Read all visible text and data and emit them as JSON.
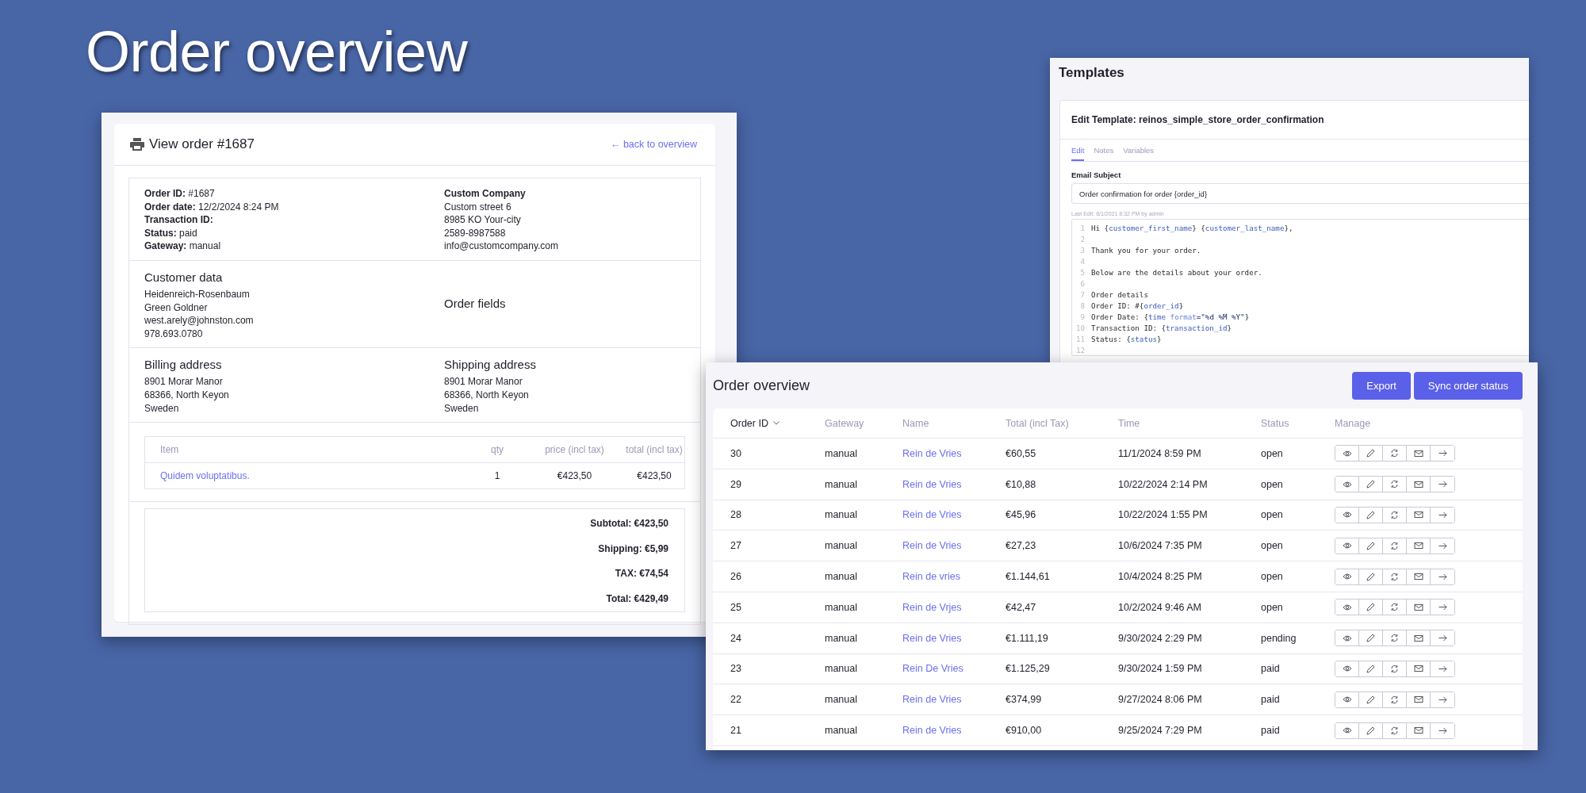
{
  "page_title": "Order overview",
  "order_view": {
    "title": "View order #1687",
    "back_link": "← back to overview",
    "details": [
      "**Order ID:** #1687",
      "**Order date:** 12/2/2024 8:24 PM",
      "**Transaction ID:**",
      "**Status:** paid",
      "**Gateway:** manual"
    ],
    "company": {
      "name": "Custom Company",
      "lines": [
        "Custom street 6",
        "8985 KO Your-city",
        "2589-8987588",
        "info@customcompany.com"
      ]
    },
    "customer": {
      "heading": "Customer data",
      "lines": [
        "Heidenreich-Rosenbaum",
        "Green Goldner",
        "west.arely@johnston.com",
        "978.693.0780"
      ]
    },
    "order_fields": {
      "heading": "Order fields"
    },
    "billing": {
      "heading": "Billing address",
      "lines": [
        "8901 Morar Manor",
        "68366, North Keyon",
        "Sweden"
      ]
    },
    "shipping": {
      "heading": "Shipping address",
      "lines": [
        "8901 Morar Manor",
        "68366, North Keyon",
        "Sweden"
      ]
    },
    "items": {
      "columns": [
        "Item",
        "qty",
        "price (incl tax)",
        "total (incl tax)"
      ],
      "rows": [
        {
          "item": "Quidem voluptatibus.",
          "qty": "1",
          "price": "€423,50",
          "total": "€423,50"
        }
      ]
    },
    "totals": [
      "Subtotal: €423,50",
      "Shipping: €5,99",
      "TAX: €74,54",
      "Total: €429,49"
    ]
  },
  "templates": {
    "title": "Templates",
    "card_title": "Edit Template: reinos_simple_store_order_confirmation",
    "tabs": [
      {
        "label": "Edit",
        "selected": true
      },
      {
        "label": "Notes",
        "selected": false
      },
      {
        "label": "Variables",
        "selected": false
      }
    ],
    "subject_label": "Email Subject",
    "subject_value": "Order confirmation for order {order_id}",
    "last_edit": "Last Edit: 6/1/2021 8:32 PM by admin",
    "code": [
      {
        "number": "1",
        "tokens": [
          {
            "kind": "text",
            "text": "Hi {"
          },
          {
            "kind": "var",
            "text": "customer_first_name"
          },
          {
            "kind": "text",
            "text": "} {"
          },
          {
            "kind": "var",
            "text": "customer_last_name"
          },
          {
            "kind": "text",
            "text": "},"
          }
        ]
      },
      {
        "number": "2"
      },
      {
        "number": "3",
        "tokens": [
          {
            "kind": "text",
            "text": "Thank you for your order."
          }
        ]
      },
      {
        "number": "4"
      },
      {
        "number": "5",
        "tokens": [
          {
            "kind": "text",
            "text": "Below are the details about your order."
          }
        ]
      },
      {
        "number": "6"
      },
      {
        "number": "7",
        "tokens": [
          {
            "kind": "text",
            "text": "Order details"
          }
        ]
      },
      {
        "number": "8",
        "tokens": [
          {
            "kind": "text",
            "text": "Order ID: #{"
          },
          {
            "kind": "var",
            "text": "order_id"
          },
          {
            "kind": "text",
            "text": "}"
          }
        ]
      },
      {
        "number": "9",
        "tokens": [
          {
            "kind": "text",
            "text": "Order Date: {"
          },
          {
            "kind": "var",
            "text": "time"
          },
          {
            "kind": "attr",
            "text": " format"
          },
          {
            "kind": "string",
            "text": "=\"%d %M %Y\""
          },
          {
            "kind": "text",
            "text": "}"
          }
        ]
      },
      {
        "number": "10",
        "tokens": [
          {
            "kind": "text",
            "text": "Transaction ID: {"
          },
          {
            "kind": "var",
            "text": "transaction_id"
          },
          {
            "kind": "text",
            "text": "}"
          }
        ]
      },
      {
        "number": "11",
        "tokens": [
          {
            "kind": "text",
            "text": "Status: {"
          },
          {
            "kind": "var",
            "text": "status"
          },
          {
            "kind": "text",
            "text": "}"
          }
        ]
      },
      {
        "number": "12"
      }
    ]
  },
  "orders": {
    "title": "Order overview",
    "buttons": [
      "Export",
      "Sync order status"
    ],
    "columns": [
      {
        "label": "Order ID",
        "sorted": true
      },
      {
        "label": "Gateway",
        "sorted": false
      },
      {
        "label": "Name",
        "sorted": false
      },
      {
        "label": "Total (incl Tax)",
        "sorted": false
      },
      {
        "label": "Time",
        "sorted": false
      },
      {
        "label": "Status",
        "sorted": false
      },
      {
        "label": "Manage",
        "sorted": false
      }
    ],
    "rows": [
      {
        "id": "30",
        "gateway": "manual",
        "name": "Rein de Vries",
        "total": "€60,55",
        "time": "11/1/2024 8:59 PM",
        "status": "open"
      },
      {
        "id": "29",
        "gateway": "manual",
        "name": "Rein de Vries",
        "total": "€10,88",
        "time": "10/22/2024 2:14 PM",
        "status": "open"
      },
      {
        "id": "28",
        "gateway": "manual",
        "name": "Rein de Vries",
        "total": "€45,96",
        "time": "10/22/2024 1:55 PM",
        "status": "open"
      },
      {
        "id": "27",
        "gateway": "manual",
        "name": "Rein de Vries",
        "total": "€27,23",
        "time": "10/6/2024 7:35 PM",
        "status": "open"
      },
      {
        "id": "26",
        "gateway": "manual",
        "name": "Rein de vries",
        "total": "€1.144,61",
        "time": "10/4/2024 8:25 PM",
        "status": "open"
      },
      {
        "id": "25",
        "gateway": "manual",
        "name": "Rein de Vrjes",
        "total": "€42,47",
        "time": "10/2/2024 9:46 AM",
        "status": "open"
      },
      {
        "id": "24",
        "gateway": "manual",
        "name": "Rein de Vries",
        "total": "€1.111,19",
        "time": "9/30/2024 2:29 PM",
        "status": "pending"
      },
      {
        "id": "23",
        "gateway": "manual",
        "name": "Rein De Vries",
        "total": "€1.125,29",
        "time": "9/30/2024 1:59 PM",
        "status": "paid"
      },
      {
        "id": "22",
        "gateway": "manual",
        "name": "Rein de Vries",
        "total": "€374,99",
        "time": "9/27/2024 8:06 PM",
        "status": "paid"
      },
      {
        "id": "21",
        "gateway": "manual",
        "name": "Rein de Vries",
        "total": "€910,00",
        "time": "9/25/2024 7:29 PM",
        "status": "paid"
      }
    ]
  }
}
